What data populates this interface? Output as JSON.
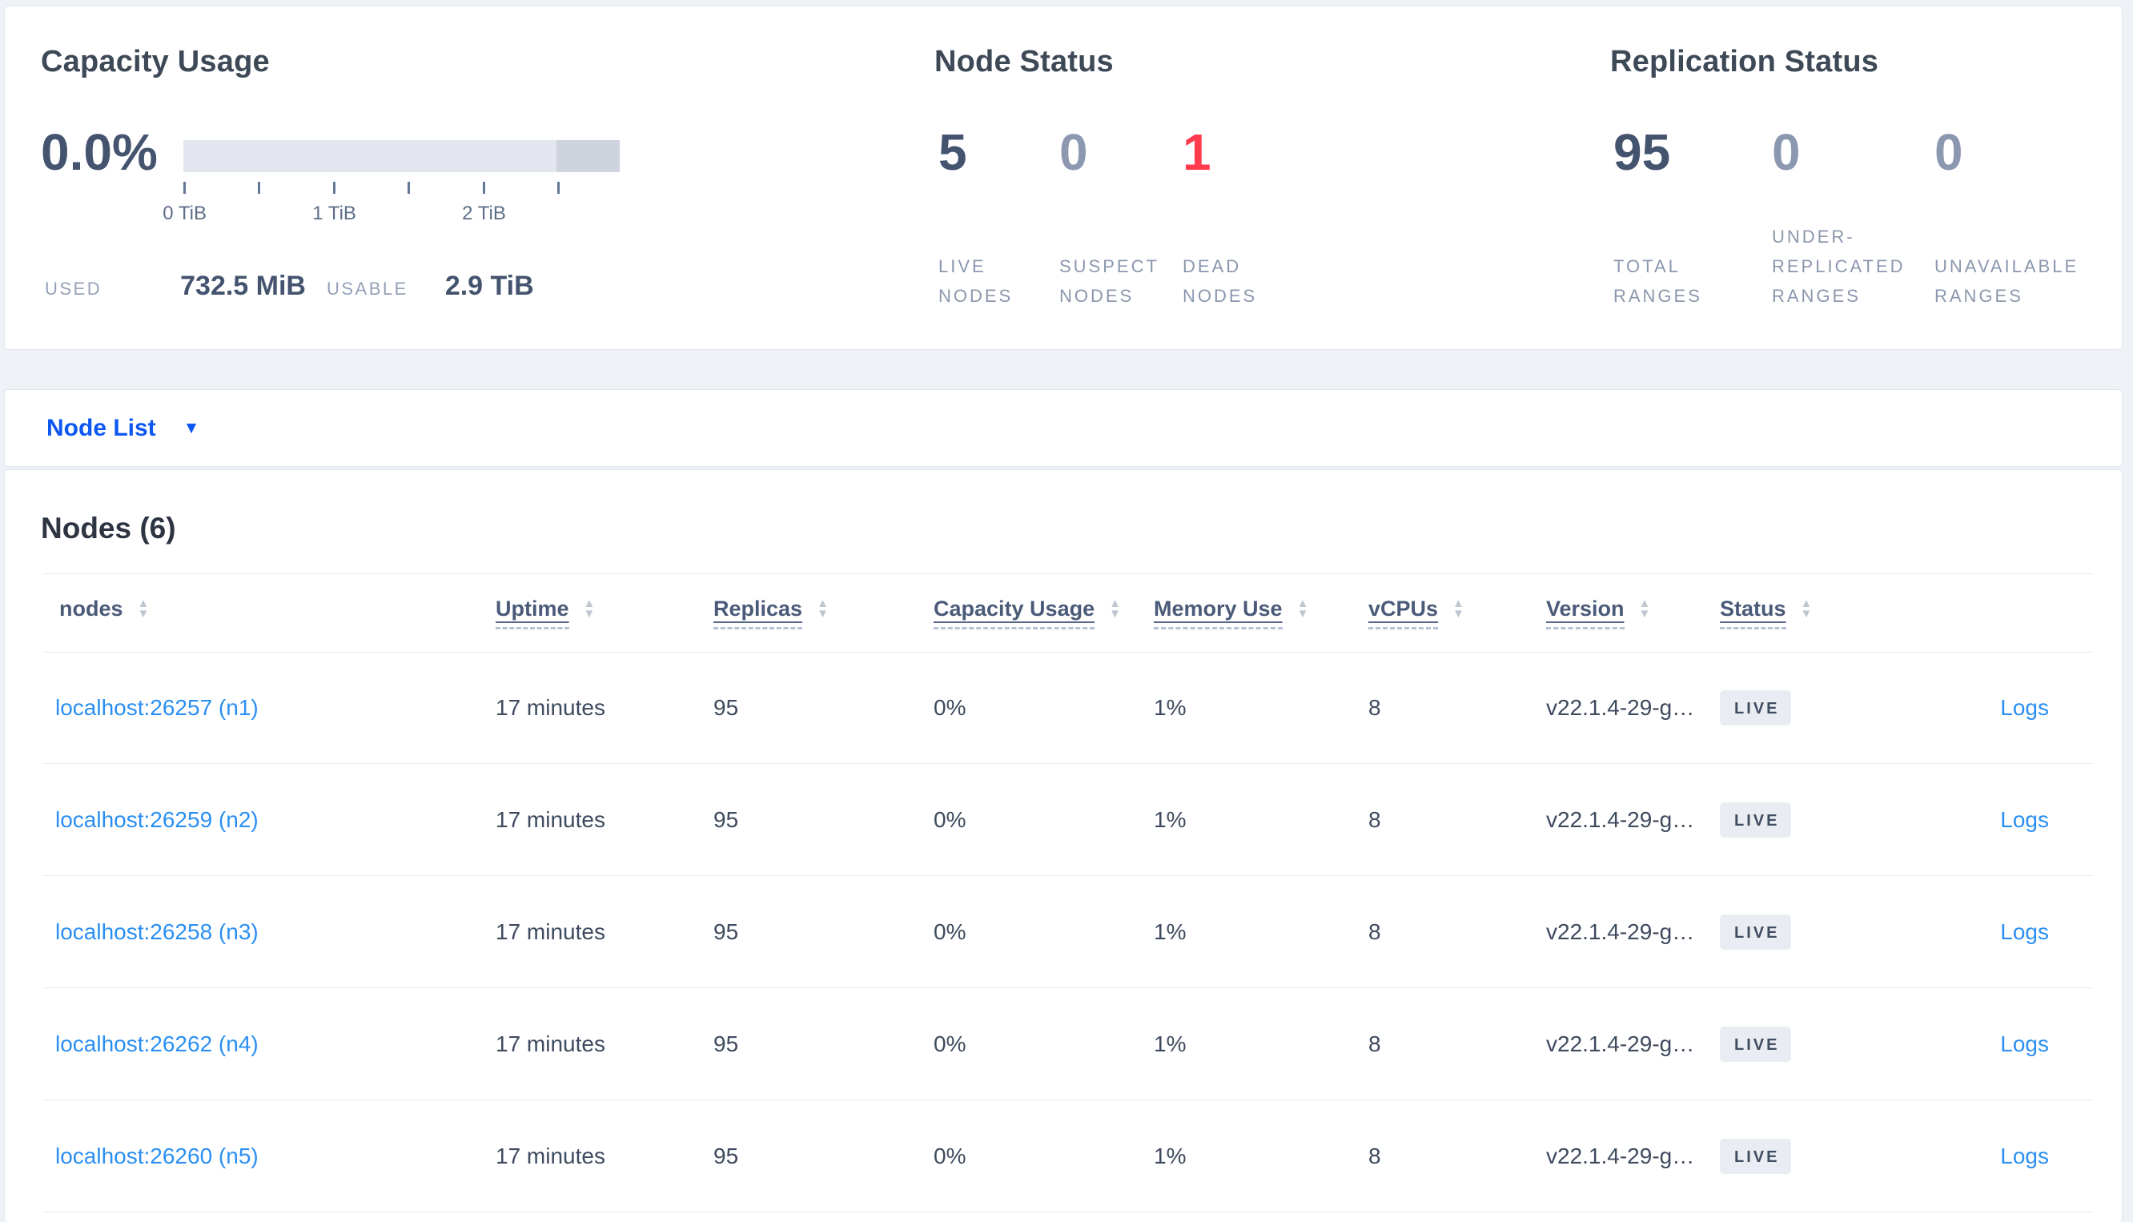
{
  "colors": {
    "page_background": "#eef1f6",
    "panel_border": "#e2e6ed",
    "title_slate": "#3e4957",
    "number_dark": "#44536e",
    "number_muted": "#8b98b0",
    "number_danger": "#ff3b4e",
    "label_muted": "#8b97ad",
    "gauge_track": "#e3e6ee",
    "gauge_tail": "#ced3de",
    "row_link_blue": "#2b8ff2",
    "selector_blue": "#0d57f2",
    "badge_background": "#e9edf3"
  },
  "capacity": {
    "title": "Capacity Usage",
    "percent": "0.0%",
    "tick_labels": [
      "0 TiB",
      "1 TiB",
      "2 TiB"
    ],
    "used_label": "USED",
    "used_value": "732.5 MiB",
    "usable_label": "USABLE",
    "usable_value": "2.9 TiB"
  },
  "node_status": {
    "title": "Node Status",
    "stats": [
      {
        "value": "5",
        "style": "dark",
        "label_lines": [
          "LIVE",
          "NODES"
        ]
      },
      {
        "value": "0",
        "style": "muted",
        "label_lines": [
          "SUSPECT",
          "NODES"
        ]
      },
      {
        "value": "1",
        "style": "danger",
        "label_lines": [
          "DEAD",
          "NODES"
        ]
      }
    ]
  },
  "replication_status": {
    "title": "Replication Status",
    "stats": [
      {
        "value": "95",
        "style": "dark",
        "label_lines": [
          "TOTAL",
          "RANGES"
        ]
      },
      {
        "value": "0",
        "style": "muted",
        "label_lines": [
          "UNDER-",
          "REPLICATED",
          "RANGES"
        ]
      },
      {
        "value": "0",
        "style": "muted",
        "label_lines": [
          "UNAVAILABLE",
          "RANGES"
        ]
      }
    ]
  },
  "view_selector": {
    "label": "Node List",
    "caret": "▼"
  },
  "sort_icon": {
    "up": "▲",
    "down": "▼"
  },
  "table": {
    "heading": "Nodes (6)",
    "columns": [
      {
        "label": "nodes"
      },
      {
        "label": "Uptime"
      },
      {
        "label": "Replicas"
      },
      {
        "label": "Capacity Usage"
      },
      {
        "label": "Memory Use"
      },
      {
        "label": "vCPUs"
      },
      {
        "label": "Version"
      },
      {
        "label": "Status"
      }
    ],
    "rows": [
      {
        "node": "localhost:26257 (n1)",
        "uptime": "17 minutes",
        "replicas": "95",
        "capacity_usage": "0%",
        "memory_use": "1%",
        "vcpus": "8",
        "version": "v22.1.4-29-g…",
        "status": "LIVE",
        "logs": "Logs"
      },
      {
        "node": "localhost:26259 (n2)",
        "uptime": "17 minutes",
        "replicas": "95",
        "capacity_usage": "0%",
        "memory_use": "1%",
        "vcpus": "8",
        "version": "v22.1.4-29-g…",
        "status": "LIVE",
        "logs": "Logs"
      },
      {
        "node": "localhost:26258 (n3)",
        "uptime": "17 minutes",
        "replicas": "95",
        "capacity_usage": "0%",
        "memory_use": "1%",
        "vcpus": "8",
        "version": "v22.1.4-29-g…",
        "status": "LIVE",
        "logs": "Logs"
      },
      {
        "node": "localhost:26262 (n4)",
        "uptime": "17 minutes",
        "replicas": "95",
        "capacity_usage": "0%",
        "memory_use": "1%",
        "vcpus": "8",
        "version": "v22.1.4-29-g…",
        "status": "LIVE",
        "logs": "Logs"
      },
      {
        "node": "localhost:26260 (n5)",
        "uptime": "17 minutes",
        "replicas": "95",
        "capacity_usage": "0%",
        "memory_use": "1%",
        "vcpus": "8",
        "version": "v22.1.4-29-g…",
        "status": "LIVE",
        "logs": "Logs"
      }
    ]
  }
}
